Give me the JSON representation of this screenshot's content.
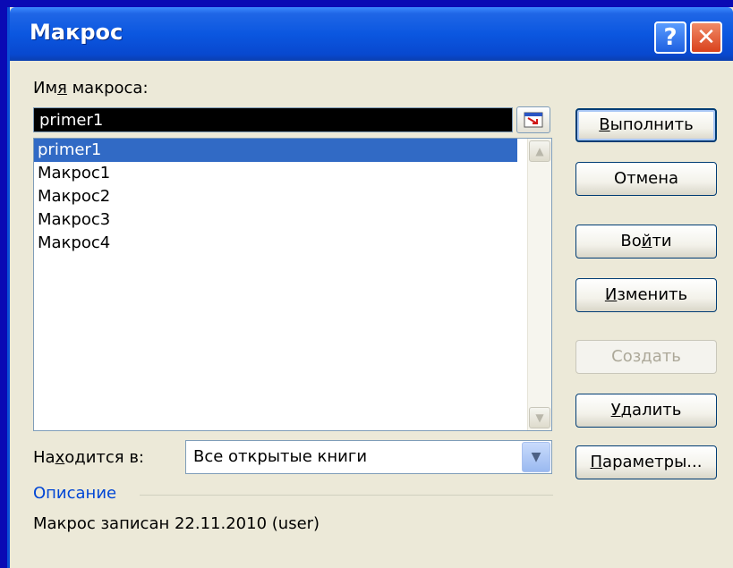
{
  "window": {
    "title": "Макрос"
  },
  "macro_name": {
    "label_pre": "Им",
    "label_accel": "я",
    "label_post": " макроса:",
    "value": "primer1"
  },
  "macro_list": {
    "items": [
      "primer1",
      "Макрос1",
      "Макрос2",
      "Макрос3",
      "Макрос4"
    ],
    "selected": "primer1"
  },
  "location": {
    "label_pre": "На",
    "label_accel": "х",
    "label_post": "одится в:",
    "value": "Все открытые книги"
  },
  "description": {
    "heading": "Описание",
    "text": "Макрос записан 22.11.2010 (user)"
  },
  "buttons": {
    "run": {
      "accel": "В",
      "rest": "ыполнить"
    },
    "cancel": {
      "label": "Отмена"
    },
    "step_pre": "Во",
    "step_accel": "й",
    "step_post": "ти",
    "edit": {
      "accel": "И",
      "rest": "зменить"
    },
    "create": {
      "label": "Создать"
    },
    "delete": {
      "accel": "У",
      "rest": "далить"
    },
    "options": {
      "accel": "П",
      "rest": "араметры..."
    }
  },
  "icons": {
    "help": "help-icon",
    "close": "close-icon",
    "collapse": "collapse-dialog-icon",
    "dropdown": "chevron-down-icon"
  },
  "colors": {
    "title_bar": "#0b57e0",
    "selection": "#316ac5",
    "dialog_bg": "#ece9d8",
    "desc_heading": "#0046d5",
    "name_field_bg": "#000000"
  }
}
